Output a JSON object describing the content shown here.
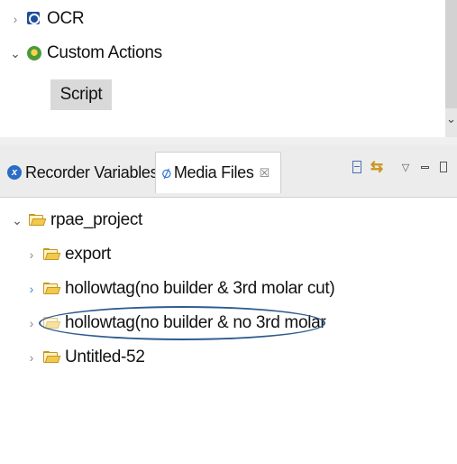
{
  "palette": {
    "items": [
      {
        "label": "OCR",
        "expanded": false,
        "icon": "ocr-icon"
      },
      {
        "label": "Custom Actions",
        "expanded": true,
        "icon": "custom-actions-icon"
      }
    ],
    "selected_child": "Script"
  },
  "tabs": [
    {
      "label": "Recorder Variables",
      "icon": "recorder-variables-icon",
      "active": false
    },
    {
      "label": "Media Files",
      "icon": "paperclip-icon",
      "active": true,
      "close": "☒"
    }
  ],
  "toolbar": {
    "collapse_all": "collapse-all-icon",
    "link_editor": "link-editor-icon",
    "view_menu": "view-menu-icon",
    "minimize": "minimize-icon",
    "maximize": "maximize-icon"
  },
  "tree": {
    "root": {
      "label": "rpae_project",
      "expanded": true
    },
    "children": [
      {
        "label": "export"
      },
      {
        "label": "hollowtag(no builder &  3rd molar cut)"
      },
      {
        "label": "hollowtag(no builder & no 3rd molar"
      },
      {
        "label": "Untitled-52"
      }
    ]
  },
  "colors": {
    "annotation_ellipse": "#2f5b8f",
    "folder": "#f2c94c",
    "tab_bar": "#ececec",
    "selection": "#d9d9d9"
  }
}
